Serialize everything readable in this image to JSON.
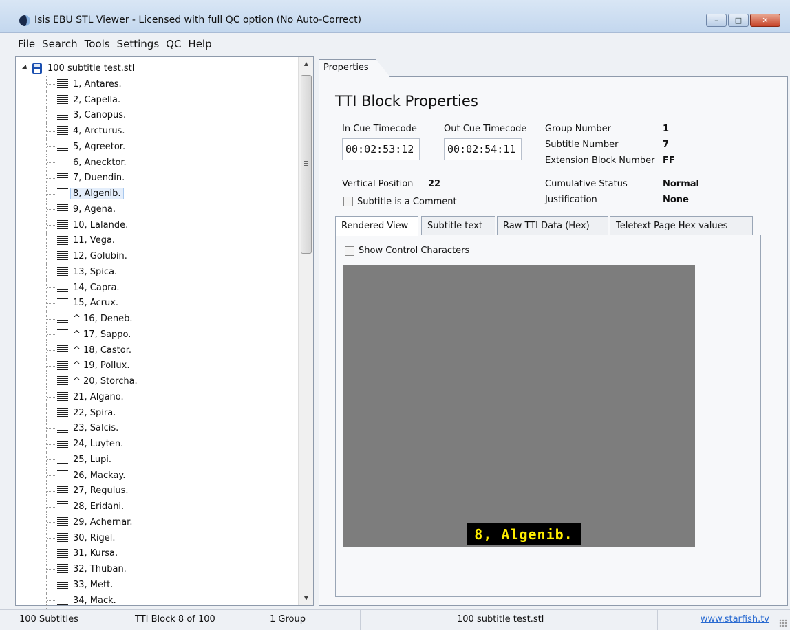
{
  "window": {
    "title": "Isis EBU STL Viewer - Licensed with full QC option (No Auto-Correct)",
    "minimize_label": "–",
    "maximize_label": "□",
    "close_label": "✕"
  },
  "menu": [
    "File",
    "Search",
    "Tools",
    "Settings",
    "QC",
    "Help"
  ],
  "tree": {
    "root_label": "100 subtitle test.stl",
    "items": [
      "1, Antares.",
      "2, Capella.",
      "3, Canopus.",
      "4, Arcturus.",
      "5, Agreetor.",
      "6, Anecktor.",
      "7, Duendin.",
      "8, Algenib.",
      "9, Agena.",
      "10, Lalande.",
      "11, Vega.",
      "12, Golubin.",
      "13, Spica.",
      "14, Capra.",
      "15, Acrux.",
      "^ 16, Deneb.",
      "^ 17, Sappo.",
      "^ 18, Castor.",
      "^ 19, Pollux.",
      "^ 20, Storcha.",
      "21, Algano.",
      "22, Spira.",
      "23, Salcis.",
      "24, Luyten.",
      "25, Lupi.",
      "26, Mackay.",
      "27, Regulus.",
      "28, Eridani.",
      "29, Achernar.",
      "30, Rigel.",
      "31, Kursa.",
      "32, Thuban.",
      "33, Mett.",
      "34, Mack."
    ],
    "selected_index": 7
  },
  "properties": {
    "tab_label": "Properties",
    "heading": "TTI Block Properties",
    "in_cue_label": "In Cue Timecode",
    "in_cue_value": "00:02:53:12",
    "out_cue_label": "Out Cue Timecode",
    "out_cue_value": "00:02:54:11",
    "group_number_label": "Group Number",
    "group_number_value": "1",
    "subtitle_number_label": "Subtitle Number",
    "subtitle_number_value": "7",
    "extension_block_label": "Extension Block Number",
    "extension_block_value": "FF",
    "vertical_position_label": "Vertical Position",
    "vertical_position_value": "22",
    "cumulative_status_label": "Cumulative Status",
    "cumulative_status_value": "Normal",
    "justification_label": "Justification",
    "justification_value": "None",
    "comment_checkbox_label": "Subtitle is a Comment"
  },
  "inner_tabs": [
    "Rendered View",
    "Subtitle text",
    "Raw TTI Data (Hex)",
    "Teletext Page Hex values"
  ],
  "rendered_view": {
    "show_control_label": "Show Control Characters",
    "subtitle_text": "8, Algenib."
  },
  "status": {
    "count": "100 Subtitles",
    "block": "TTI Block 8 of 100",
    "groups": "1 Group",
    "file": "100 subtitle test.stl",
    "link": "www.starfish.tv"
  }
}
